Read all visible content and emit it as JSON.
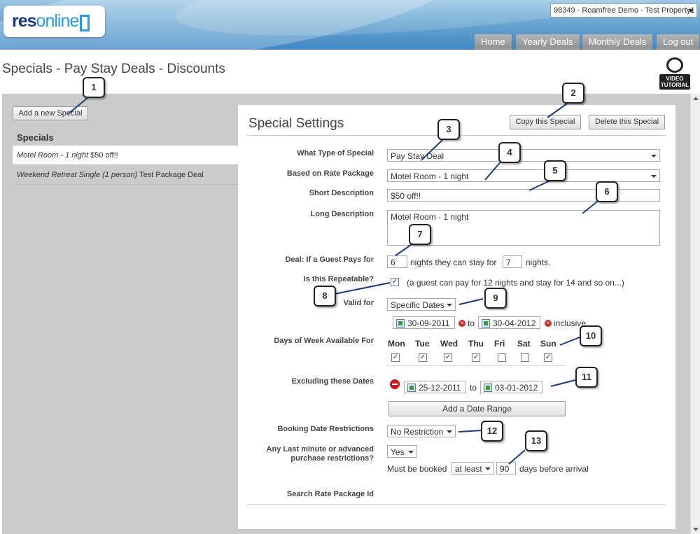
{
  "header": {
    "logo_res": "res",
    "logo_online": "online",
    "property": "98349 - Roamfree Demo - Test Property1",
    "nav": [
      "Home",
      "Yearly Deals",
      "Monthly Deals",
      "Log out"
    ]
  },
  "page_title": "Specials - Pay Stay Deals - Discounts",
  "video_label": "VIDEO TUTORIAL",
  "sidebar": {
    "add_button": "Add a new Special",
    "heading": "Specials",
    "items": [
      {
        "italic": "Motel Room - 1 night",
        "rest": " $50 off!!"
      },
      {
        "italic": "Weekend Retreat Single (1 person)",
        "rest": " Test Package Deal"
      }
    ]
  },
  "panel": {
    "title": "Special Settings",
    "copy_button": "Copy this Special",
    "delete_button": "Delete this Special",
    "labels": {
      "type": "What Type of Special",
      "rate_package": "Based on Rate Package",
      "short_desc": "Short Description",
      "long_desc": "Long Description",
      "deal": "Deal: If a Guest Pays for",
      "repeatable": "Is this Repeatable?",
      "valid_for": "Valid for",
      "days": "Days of Week Available For",
      "excluding": "Excluding these Dates",
      "booking": "Booking Date Restrictions",
      "lastmin_1": "Any Last minute or advanced",
      "lastmin_2": "purchase restrictions?",
      "search": "Search Rate Package Id"
    },
    "type_value": "Pay Stay Deal",
    "rate_package_value": "Motel Room - 1 night",
    "short_desc_value": "$50 off!!",
    "long_desc_value": "Motel Room - 1 night",
    "pay_nights": "6",
    "deal_mid": "nights they can stay for",
    "stay_nights": "7",
    "deal_end": "nights.",
    "repeatable_note": "(a guest can pay for 12 nights and stay for 14 and so on...)",
    "valid_for_value": "Specific Dates",
    "valid_from": "30-09-2011",
    "to": "to",
    "valid_to": "30-04-2012",
    "inclusive": "inclusive",
    "days": [
      {
        "name": "Mon",
        "checked": true
      },
      {
        "name": "Tue",
        "checked": true
      },
      {
        "name": "Wed",
        "checked": true
      },
      {
        "name": "Thu",
        "checked": true
      },
      {
        "name": "Fri",
        "checked": false
      },
      {
        "name": "Sat",
        "checked": false
      },
      {
        "name": "Sun",
        "checked": true
      }
    ],
    "exclude_from": "25-12-2011",
    "exclude_to": "03-01-2012",
    "add_range_button": "Add a Date Range",
    "booking_value": "No Restriction",
    "lastmin_value": "Yes",
    "must_be_booked": "Must be booked",
    "at_least": "at least",
    "days_before": "90",
    "days_before_text": "days before arrival"
  },
  "callouts": [
    "1",
    "2",
    "3",
    "4",
    "5",
    "6",
    "7",
    "8",
    "9",
    "10",
    "11",
    "12",
    "13"
  ]
}
